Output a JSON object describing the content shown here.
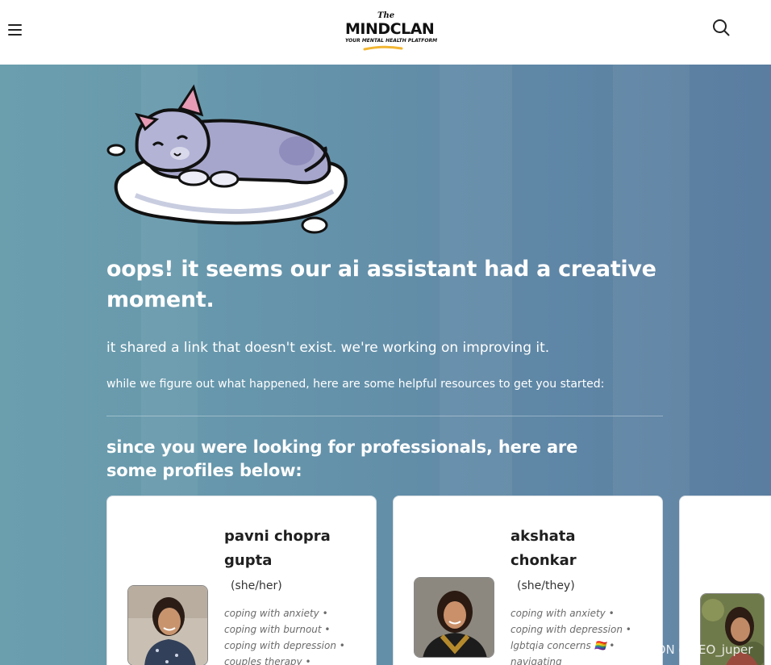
{
  "header": {
    "logo_the": "The",
    "logo_name": "MINDCLAN",
    "logo_tagline": "YOUR MENTAL HEALTH PLATFORM"
  },
  "hero": {
    "headline": "oops! it seems our ai assistant had a creative moment.",
    "subline": "it shared a link that doesn't exist. we're working on improving it.",
    "helper": "while we figure out what happened, here are some helpful resources to get you started:",
    "section_title": "since you were looking for professionals, here are some profiles below:"
  },
  "profiles": [
    {
      "name": "pavni chopra gupta",
      "pronouns": "(she/her)",
      "tags": "coping with anxiety • coping with burnout • coping with depression • couples therapy •"
    },
    {
      "name": "akshata chonkar",
      "pronouns": "(she/they)",
      "tags": "coping with anxiety • coping with depression • lgbtqia concerns 🏳️‍🌈 • navigating"
    }
  ],
  "watermark": "CSDN @SEO_juper",
  "colors": {
    "hero_left": "#6b9fae",
    "hero_right": "#5a7da0",
    "text_on_hero": "#ffffff",
    "card_bg": "#ffffff",
    "logo_swoosh": "#f2b632"
  },
  "icons": [
    "menu-icon",
    "search-icon"
  ]
}
